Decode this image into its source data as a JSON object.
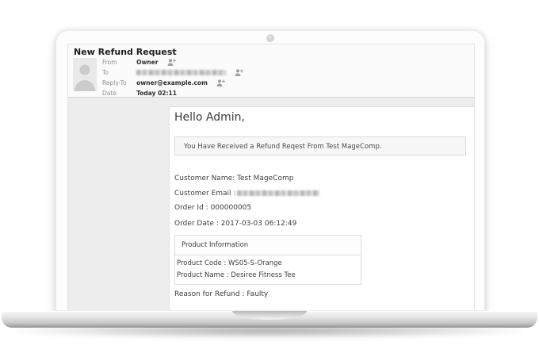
{
  "email": {
    "title": "New Refund Request",
    "header_fields": [
      {
        "label": "From",
        "value": "Owner",
        "blurred": false,
        "person_icon": true
      },
      {
        "label": "To",
        "value": "",
        "blurred": true,
        "person_icon": true
      },
      {
        "label": "Reply-To",
        "value": "owner@example.com",
        "blurred": false,
        "person_icon": true
      },
      {
        "label": "Date",
        "value": "Today 02:11",
        "blurred": false,
        "person_icon": false
      }
    ],
    "body": {
      "greeting": "Hello Admin,",
      "notice": "You Have Received a Refund Reqest From Test MageComp.",
      "details": [
        {
          "label": "Customer Name:",
          "value": " Test MageComp",
          "blurred": false
        },
        {
          "label": "Customer Email :",
          "value": "",
          "blurred": true
        },
        {
          "label": "Order Id :",
          "value": " 000000005",
          "blurred": false
        },
        {
          "label": "Order Date :",
          "value": " 2017-03-03 06:12:49",
          "blurred": false
        }
      ],
      "product_table": {
        "header": "Product Information",
        "rows": [
          "Product Code : WS05-S-Orange",
          "Product Name : Desiree Fitness Tee"
        ]
      },
      "reason": "Reason for Refund : Faulty"
    }
  },
  "colors": {
    "body_bg": "#ededed",
    "panel_bg": "#ffffff",
    "notice_bg": "#f7f7f7",
    "border": "#dcdcdc",
    "text": "#3e3e3e",
    "label": "#909090"
  }
}
